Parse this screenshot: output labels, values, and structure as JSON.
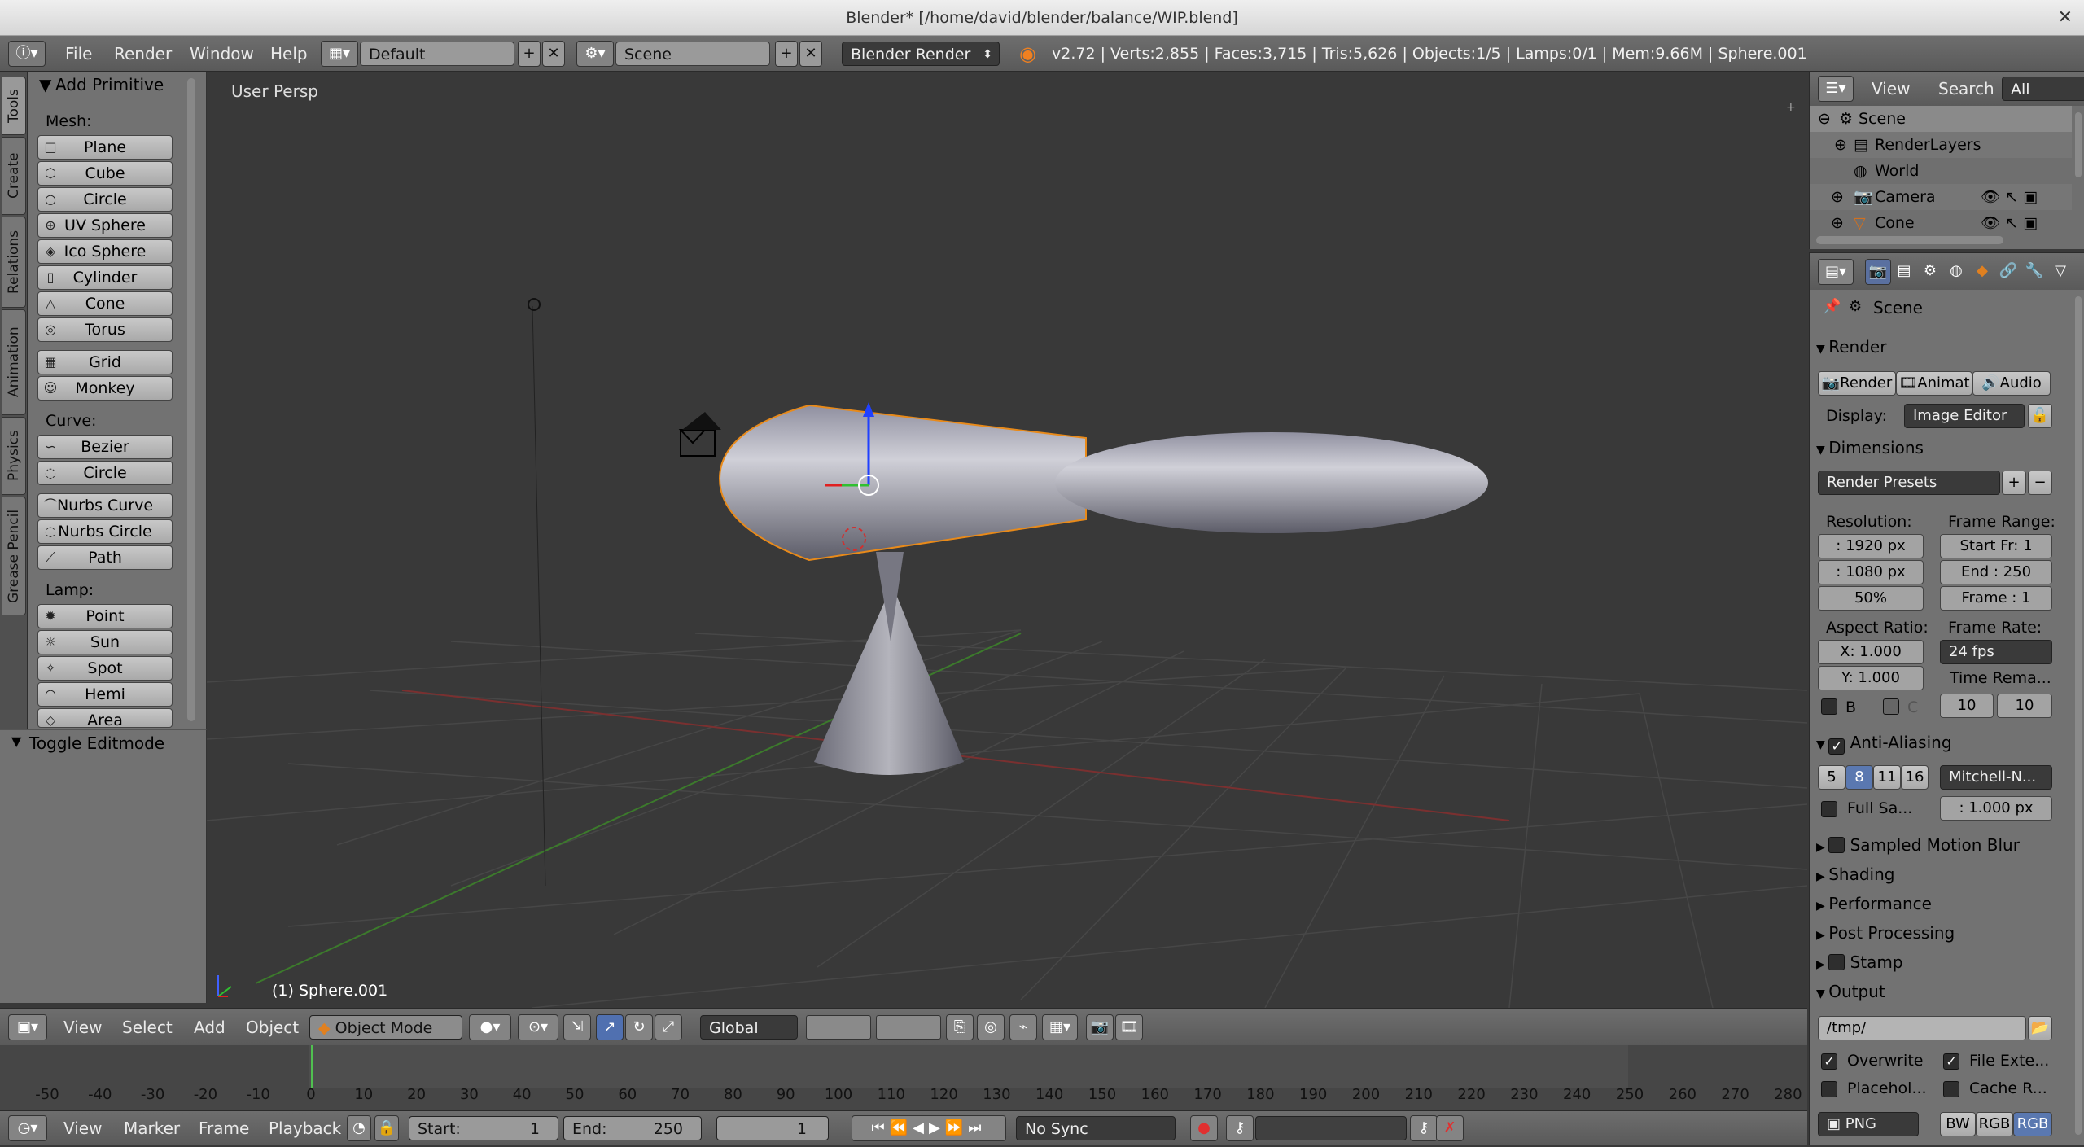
{
  "window": {
    "title": "Blender* [/home/david/blender/balance/WIP.blend]"
  },
  "menubar": {
    "items": [
      "File",
      "Render",
      "Window",
      "Help"
    ],
    "screen_layout": "Default",
    "scene": "Scene",
    "engine": "Blender Render",
    "info": "v2.72 | Verts:2,855 | Faces:3,715 | Tris:5,626 | Objects:1/5 | Lamps:0/1 | Mem:9.66M | Sphere.001"
  },
  "left_tabs": [
    "Tools",
    "Create",
    "Relations",
    "Animation",
    "Physics",
    "Grease Pencil"
  ],
  "toolshelf": {
    "panel_title": "Add Primitive",
    "mesh_label": "Mesh:",
    "mesh": [
      "Plane",
      "Cube",
      "Circle",
      "UV Sphere",
      "Ico Sphere",
      "Cylinder",
      "Cone",
      "Torus",
      "Grid",
      "Monkey"
    ],
    "curve_label": "Curve:",
    "curve": [
      "Bezier",
      "Circle",
      "Nurbs Curve",
      "Nurbs Circle",
      "Path"
    ],
    "lamp_label": "Lamp:",
    "lamp": [
      "Point",
      "Sun",
      "Spot",
      "Hemi",
      "Area"
    ],
    "operator_panel": "Toggle Editmode"
  },
  "viewport": {
    "view_label": "User Persp",
    "object_label": "(1) Sphere.001"
  },
  "view3d_header": {
    "menus": [
      "View",
      "Select",
      "Add",
      "Object"
    ],
    "mode": "Object Mode",
    "orientation": "Global"
  },
  "timeline": {
    "ticks": [
      "-50",
      "-40",
      "-30",
      "-20",
      "-10",
      "0",
      "10",
      "20",
      "30",
      "40",
      "50",
      "60",
      "70",
      "80",
      "90",
      "100",
      "110",
      "120",
      "130",
      "140",
      "150",
      "160",
      "170",
      "180",
      "190",
      "200",
      "210",
      "220",
      "230",
      "240",
      "250",
      "260",
      "270",
      "280"
    ],
    "menus": [
      "View",
      "Marker",
      "Frame",
      "Playback"
    ],
    "start_label": "Start:",
    "start_value": "1",
    "end_label": "End:",
    "end_value": "250",
    "current": "1",
    "sync": "No Sync"
  },
  "outliner": {
    "header": [
      "View",
      "Search",
      "All Scenes"
    ],
    "rows": [
      "Scene",
      "RenderLayers",
      "World",
      "Camera",
      "Cone"
    ]
  },
  "properties": {
    "context": "Scene",
    "render_section": "Render",
    "render_buttons": [
      "Render",
      "Animat",
      "Audio"
    ],
    "display_label": "Display:",
    "display_value": "Image Editor",
    "dimensions": "Dimensions",
    "render_presets": "Render Presets",
    "resolution_label": "Resolution:",
    "res_x": ": 1920 px",
    "res_y": ": 1080 px",
    "res_pct": "50%",
    "frame_range_label": "Frame Range:",
    "start_fr": "Start Fr: 1",
    "end_fr": "End : 250",
    "frame": "Frame : 1",
    "aspect_label": "Aspect Ratio:",
    "aspect_x": "X:  1.000",
    "aspect_y": "Y:  1.000",
    "frame_rate_label": "Frame Rate:",
    "frame_rate": "24 fps",
    "time_remap": "Time Rema...",
    "remap_old": "10",
    "remap_new": "10",
    "b_label": "B",
    "c_label": "C",
    "aa": "Anti-Aliasing",
    "aa_samples": [
      "5",
      "8",
      "11",
      "16"
    ],
    "aa_filter": "Mitchell-N...",
    "full_sample": "Full Sa...",
    "filter_size": ": 1.000 px",
    "motion_blur": "Sampled Motion Blur",
    "shading": "Shading",
    "performance": "Performance",
    "post_processing": "Post Processing",
    "stamp": "Stamp",
    "output": "Output",
    "output_path": "/tmp/",
    "overwrite": "Overwrite",
    "file_ext": "File Exte...",
    "placeholders": "Placehol...",
    "cache_result": "Cache R...",
    "format": "PNG",
    "color_modes": [
      "BW",
      "RGB",
      "RGB"
    ]
  }
}
